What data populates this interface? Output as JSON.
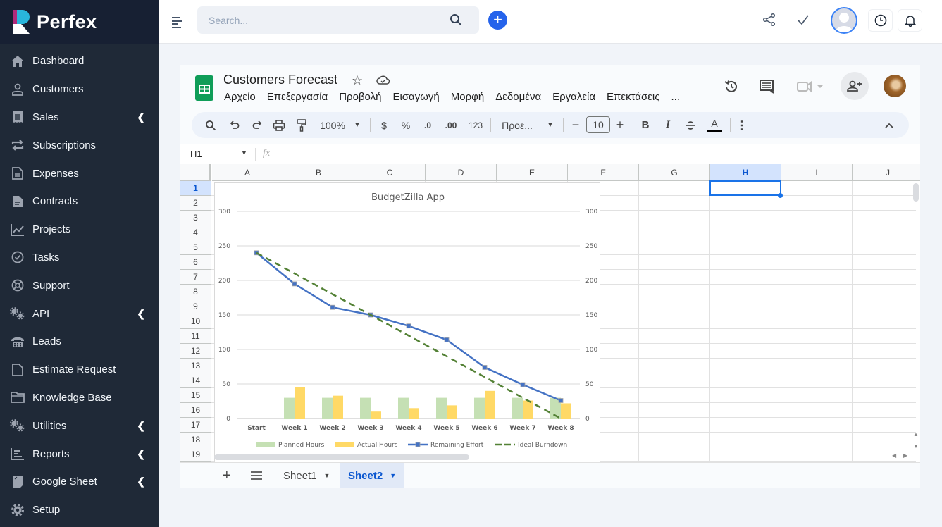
{
  "app": {
    "brand": "Perfex",
    "accent": "#2563eb"
  },
  "sidebar": {
    "items": [
      {
        "label": "Dashboard",
        "icon": "home-icon",
        "expandable": false
      },
      {
        "label": "Customers",
        "icon": "user-icon",
        "expandable": false
      },
      {
        "label": "Sales",
        "icon": "receipt-icon",
        "expandable": true
      },
      {
        "label": "Subscriptions",
        "icon": "repeat-icon",
        "expandable": false
      },
      {
        "label": "Expenses",
        "icon": "file-text-icon",
        "expandable": false
      },
      {
        "label": "Contracts",
        "icon": "contract-icon",
        "expandable": false
      },
      {
        "label": "Projects",
        "icon": "chart-icon",
        "expandable": false
      },
      {
        "label": "Tasks",
        "icon": "check-circle-icon",
        "expandable": false
      },
      {
        "label": "Support",
        "icon": "lifebuoy-icon",
        "expandable": false
      },
      {
        "label": "API",
        "icon": "cogs-icon",
        "expandable": true
      },
      {
        "label": "Leads",
        "icon": "phone-icon",
        "expandable": false
      },
      {
        "label": "Estimate Request",
        "icon": "file-icon",
        "expandable": false
      },
      {
        "label": "Knowledge Base",
        "icon": "folder-icon",
        "expandable": false
      },
      {
        "label": "Utilities",
        "icon": "cogs-icon",
        "expandable": true
      },
      {
        "label": "Reports",
        "icon": "bar-chart-icon",
        "expandable": true
      },
      {
        "label": "Google Sheet",
        "icon": "sheet-icon",
        "expandable": true
      },
      {
        "label": "Setup",
        "icon": "gear-icon",
        "expandable": false
      }
    ]
  },
  "topbar": {
    "search_placeholder": "Search..."
  },
  "spreadsheet": {
    "title": "Customers Forecast",
    "menu": [
      "Αρχείο",
      "Επεξεργασία",
      "Προβολή",
      "Εισαγωγή",
      "Μορφή",
      "Δεδομένα",
      "Εργαλεία",
      "Επεκτάσεις",
      "..."
    ],
    "toolbar": {
      "zoom": "100%",
      "currency": "$",
      "percent": "%",
      "dec_less": ".0",
      "dec_more": ".00",
      "format_123": "123",
      "font": "Προε...",
      "font_size": "10",
      "bold": "B",
      "italic": "I",
      "text_color": "A"
    },
    "name_box": "H1",
    "fx": "fx",
    "columns": [
      "A",
      "B",
      "C",
      "D",
      "E",
      "F",
      "G",
      "H",
      "I",
      "J"
    ],
    "rows": [
      "1",
      "2",
      "3",
      "4",
      "5",
      "6",
      "7",
      "8",
      "9",
      "10",
      "11",
      "12",
      "13",
      "14",
      "15",
      "16",
      "17",
      "18",
      "19"
    ],
    "selected_cell": "H1",
    "sheets": [
      {
        "name": "Sheet1",
        "active": false
      },
      {
        "name": "Sheet2",
        "active": true
      }
    ]
  },
  "chart_data": {
    "type": "bar",
    "title": "BudgetZilla App",
    "categories": [
      "Start",
      "Week 1",
      "Week 2",
      "Week 3",
      "Week 4",
      "Week 5",
      "Week 6",
      "Week 7",
      "Week 8"
    ],
    "ylim": [
      0,
      300
    ],
    "yticks": [
      0,
      50,
      100,
      150,
      200,
      250,
      300
    ],
    "grid": true,
    "legend": "bottom",
    "series": [
      {
        "name": "Planned Hours",
        "kind": "bar",
        "color": "#c5e0b4",
        "values": [
          null,
          30,
          30,
          30,
          30,
          30,
          30,
          30,
          30
        ]
      },
      {
        "name": "Actual Hours",
        "kind": "bar",
        "color": "#ffd966",
        "values": [
          null,
          45,
          33,
          10,
          15,
          19,
          40,
          26,
          22
        ]
      },
      {
        "name": "Remaining Effort",
        "kind": "line",
        "color": "#4472c4",
        "values": [
          240,
          195,
          161,
          150,
          134,
          114,
          74,
          49,
          26
        ]
      },
      {
        "name": "Ideal Burndown",
        "kind": "dashed-line",
        "color": "#538135",
        "values": [
          240,
          210,
          180,
          150,
          120,
          90,
          60,
          30,
          0
        ]
      }
    ]
  }
}
